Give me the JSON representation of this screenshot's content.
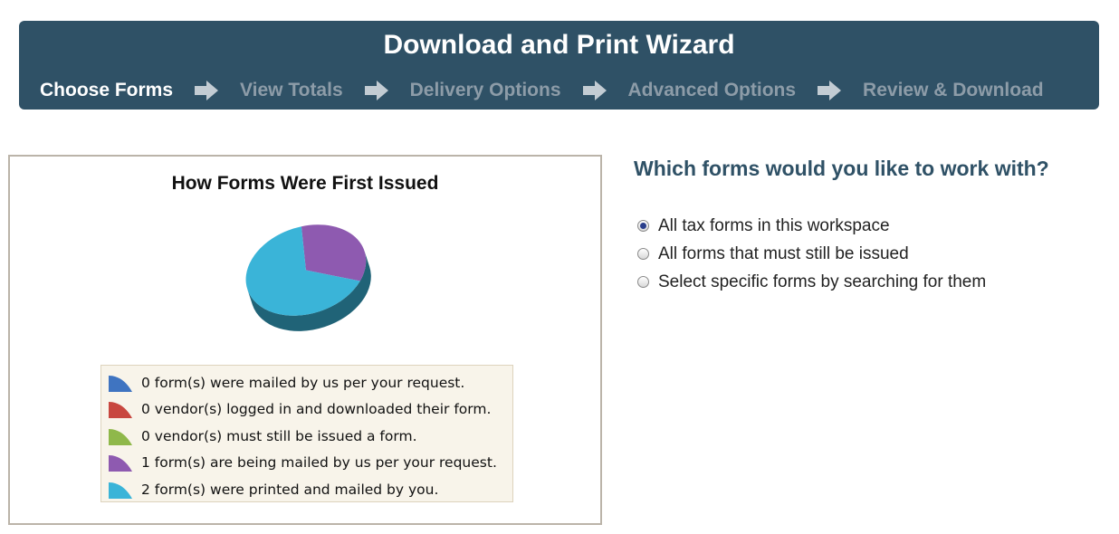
{
  "wizard": {
    "title": "Download and Print Wizard",
    "steps": [
      {
        "label": "Choose Forms",
        "active": true
      },
      {
        "label": "View Totals",
        "active": false
      },
      {
        "label": "Delivery Options",
        "active": false
      },
      {
        "label": "Advanced Options",
        "active": false
      },
      {
        "label": "Review & Download",
        "active": false
      }
    ],
    "arrow_icon": "right-arrow-icon"
  },
  "chart_data": {
    "type": "pie",
    "title": "How Forms Were First Issued",
    "slices": [
      {
        "label": "0 form(s) were mailed by us per your request.",
        "value": 0,
        "color": "#3f74c1"
      },
      {
        "label": "0 vendor(s) logged in and downloaded their form.",
        "value": 0,
        "color": "#c8473f"
      },
      {
        "label": "0 vendor(s) must still be issued a form.",
        "value": 0,
        "color": "#8fb84a"
      },
      {
        "label": "1 form(s) are being mailed by us per your request.",
        "value": 1,
        "color": "#8e5ab0"
      },
      {
        "label": "2 form(s) were printed and mailed by you.",
        "value": 2,
        "color": "#3ab4d8"
      }
    ]
  },
  "question": {
    "title": "Which forms would you like to work with?",
    "options": [
      {
        "label": "All tax forms in this workspace",
        "checked": true
      },
      {
        "label": "All forms that must still be issued",
        "checked": false
      },
      {
        "label": "Select specific forms by searching for them",
        "checked": false
      }
    ]
  },
  "colors": {
    "header_bg": "#2f5166",
    "inactive_step": "#8d9ca8",
    "question_text": "#2f5166"
  }
}
